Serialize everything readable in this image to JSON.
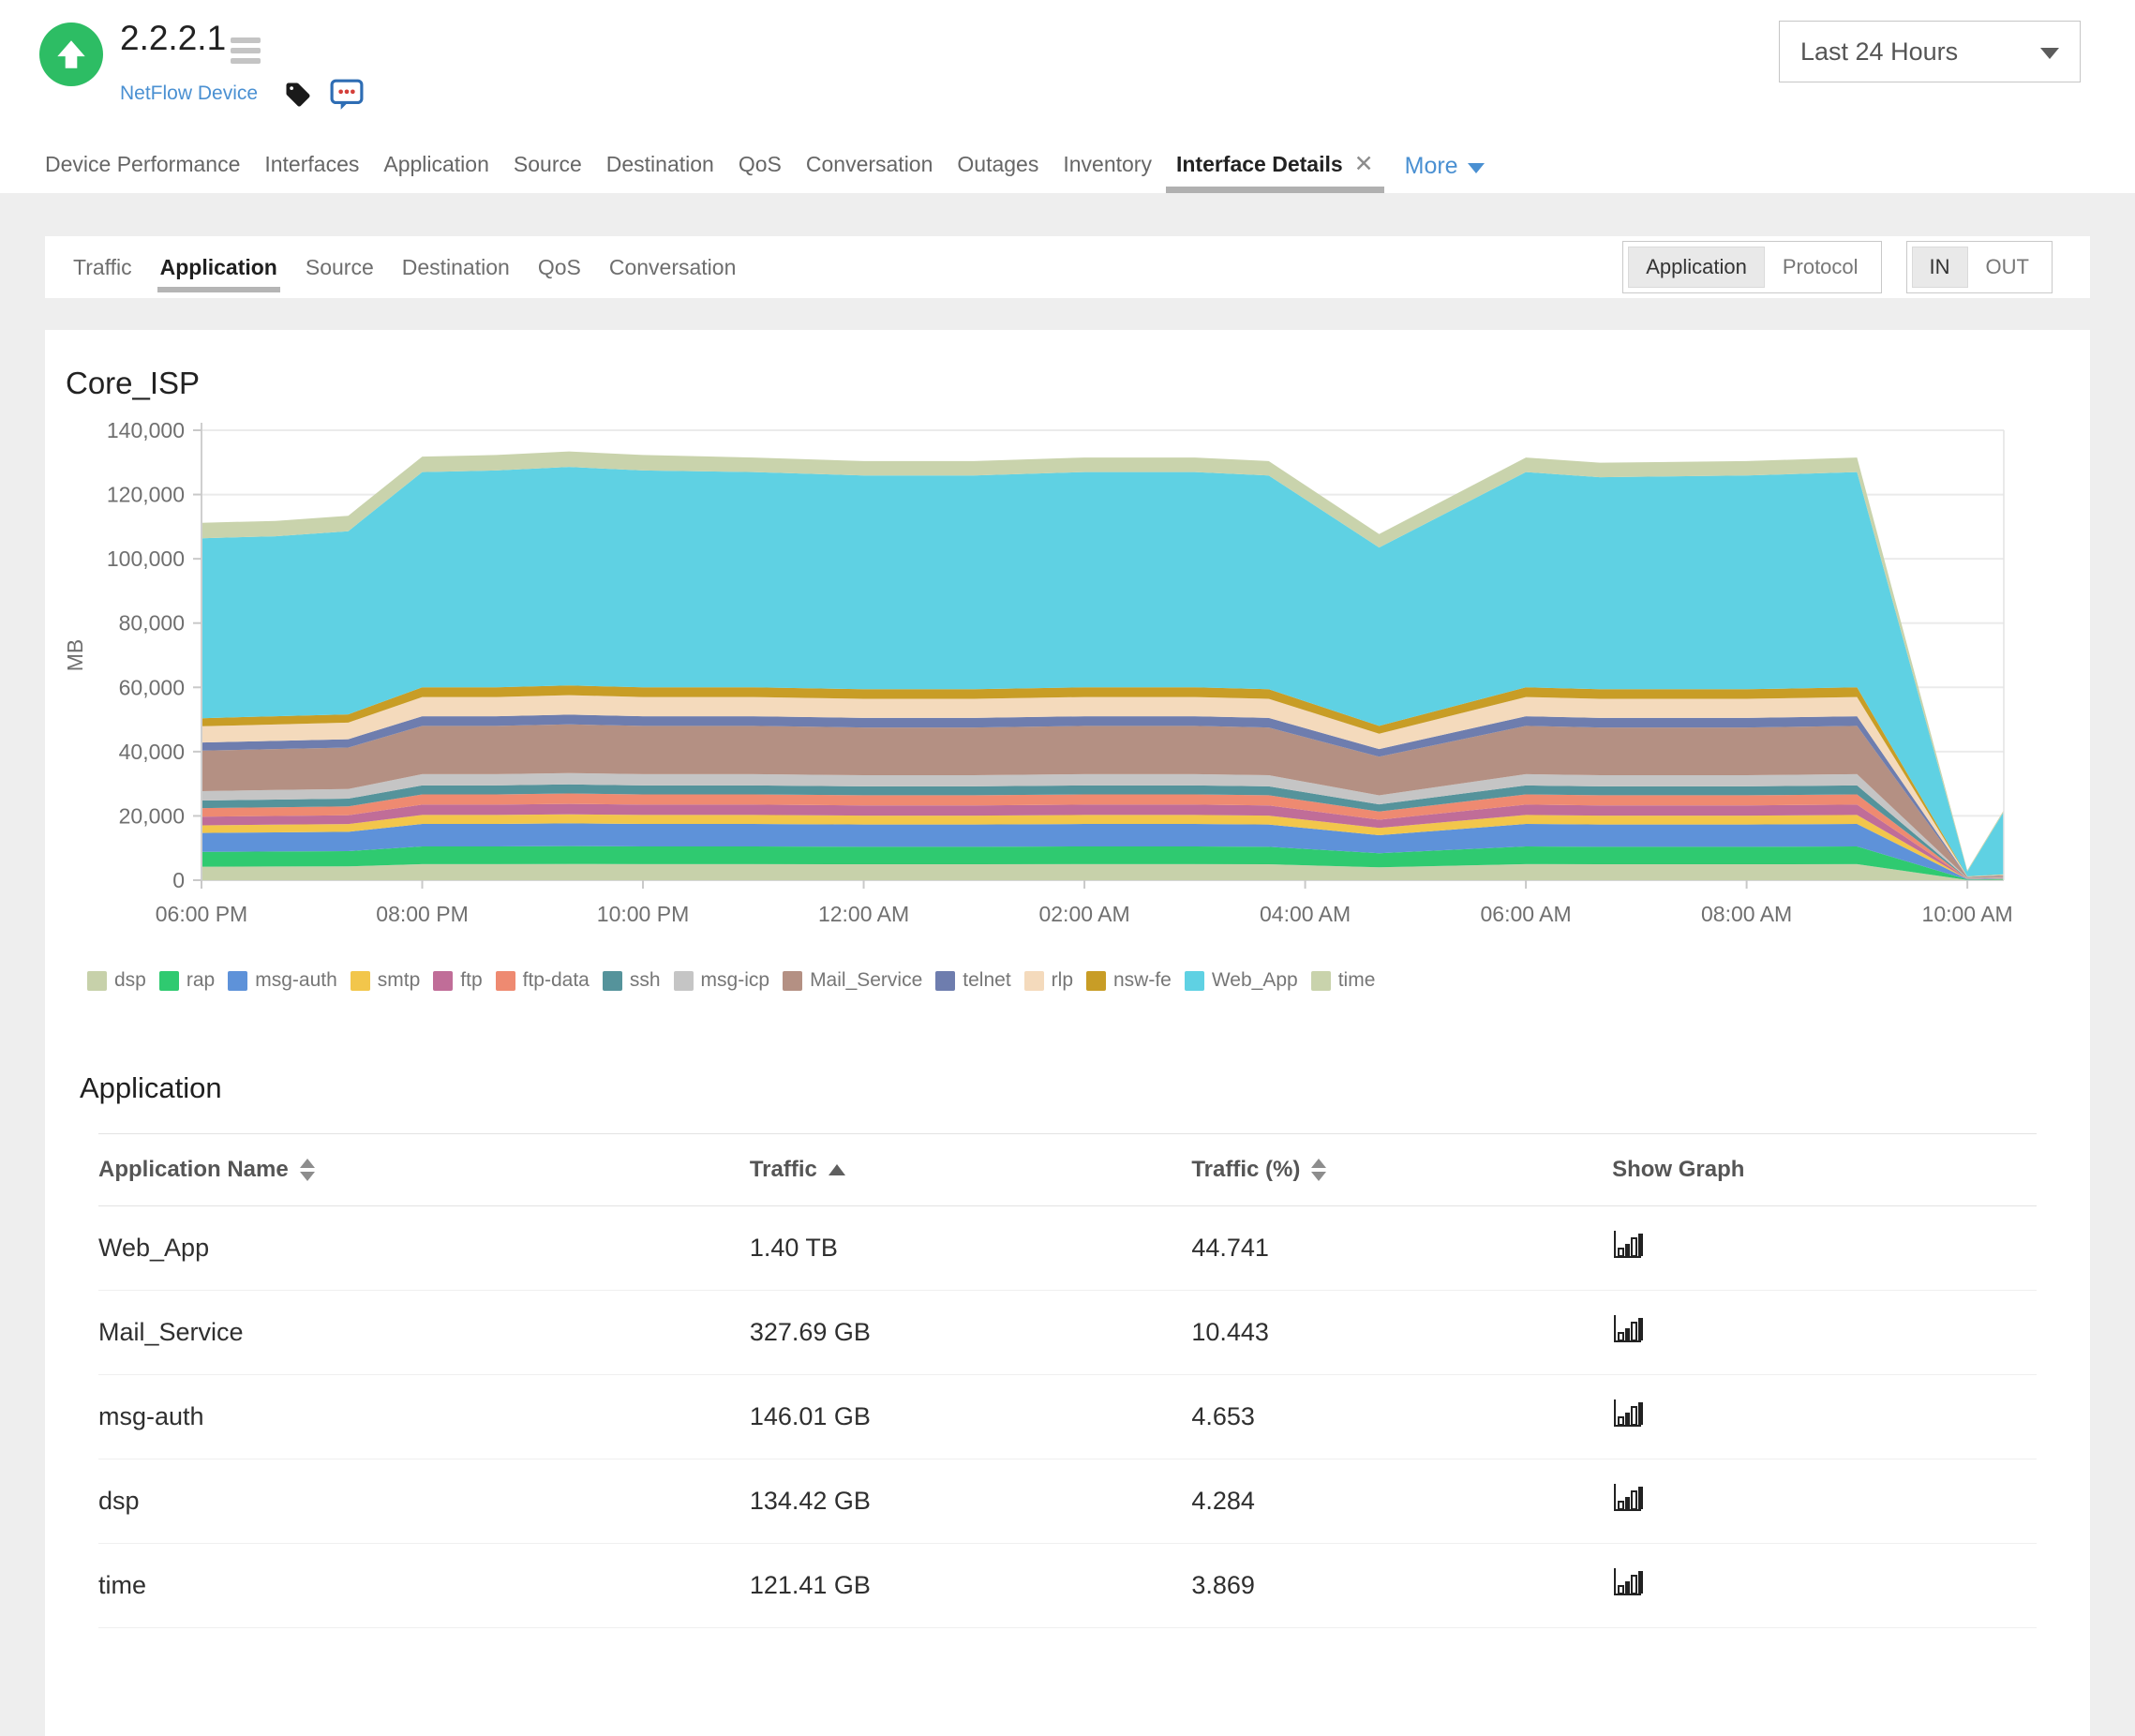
{
  "header": {
    "device_title": "2.2.2.1",
    "device_type": "NetFlow Device",
    "status": "up",
    "status_color": "#2dbd64",
    "time_range": "Last 24 Hours"
  },
  "nav": {
    "tabs": [
      "Device Performance",
      "Interfaces",
      "Application",
      "Source",
      "Destination",
      "QoS",
      "Conversation",
      "Outages",
      "Inventory"
    ],
    "active_tab": "Interface Details",
    "more_label": "More"
  },
  "subnav": {
    "tabs": [
      "Traffic",
      "Application",
      "Source",
      "Destination",
      "QoS",
      "Conversation"
    ],
    "active": "Application",
    "view_toggle": {
      "options": [
        "Application",
        "Protocol"
      ],
      "selected": "Application"
    },
    "direction_toggle": {
      "options": [
        "IN",
        "OUT"
      ],
      "selected": "IN"
    }
  },
  "chart": {
    "title": "Core_ISP",
    "ylabel": "MB"
  },
  "chart_data": {
    "type": "area",
    "stacked": true,
    "title": "Core_ISP",
    "ylabel": "MB",
    "ylim": [
      0,
      140000
    ],
    "yticks": [
      0,
      20000,
      40000,
      60000,
      80000,
      100000,
      120000,
      140000
    ],
    "grid": true,
    "legend_position": "bottom",
    "x_unit": "hours since 06:00 PM",
    "x_span": [
      0,
      16.33
    ],
    "x_hours": [
      0,
      0.67,
      1.33,
      2,
      2.67,
      3.33,
      4,
      5,
      6,
      7,
      8,
      9,
      9.67,
      10.67,
      12,
      12.67,
      14,
      15,
      16,
      16.33
    ],
    "xtick_hours": [
      0,
      2,
      4,
      6,
      8,
      10,
      12,
      14,
      16
    ],
    "xtick_labels": [
      "06:00 PM",
      "08:00 PM",
      "10:00 PM",
      "12:00 AM",
      "02:00 AM",
      "04:00 AM",
      "06:00 AM",
      "08:00 AM",
      "10:00 AM"
    ],
    "series": [
      {
        "name": "dsp",
        "color": "#c7d1aa",
        "values": [
          4200,
          4250,
          4300,
          5000,
          5000,
          5050,
          5000,
          5000,
          4950,
          4950,
          5000,
          5000,
          4950,
          4000,
          5000,
          4950,
          4950,
          5000,
          100,
          150
        ]
      },
      {
        "name": "rap",
        "color": "#2fca70",
        "values": [
          4620,
          4675,
          4730,
          5500,
          5500,
          5555,
          5500,
          5500,
          5445,
          5445,
          5500,
          5500,
          5445,
          4400,
          5500,
          5445,
          5445,
          5500,
          110,
          165
        ]
      },
      {
        "name": "msg-auth",
        "color": "#5e92d9",
        "values": [
          5880,
          5950,
          6020,
          7000,
          7000,
          7070,
          7000,
          7000,
          6930,
          6930,
          7000,
          7000,
          6930,
          5600,
          7000,
          6930,
          6930,
          7000,
          140,
          210
        ]
      },
      {
        "name": "smtp",
        "color": "#f2c64b",
        "values": [
          2352,
          2380,
          2408,
          2800,
          2800,
          2828,
          2800,
          2800,
          2772,
          2772,
          2800,
          2800,
          2772,
          2240,
          2800,
          2772,
          2772,
          2800,
          56,
          84
        ]
      },
      {
        "name": "ftp",
        "color": "#c06d98",
        "values": [
          2688,
          2720,
          2752,
          3200,
          3200,
          3232,
          3200,
          3200,
          3168,
          3168,
          3200,
          3200,
          3168,
          2560,
          3200,
          3168,
          3168,
          3200,
          64,
          96
        ]
      },
      {
        "name": "ftp-data",
        "color": "#ee8a71",
        "values": [
          2688,
          2720,
          2752,
          3200,
          3200,
          3232,
          3200,
          3200,
          3168,
          3168,
          3200,
          3200,
          3168,
          2560,
          3200,
          3168,
          3168,
          3200,
          64,
          96
        ]
      },
      {
        "name": "ssh",
        "color": "#55939b",
        "values": [
          2352,
          2380,
          2408,
          2800,
          2800,
          2828,
          2800,
          2800,
          2772,
          2772,
          2800,
          2800,
          2772,
          2240,
          2800,
          2772,
          2772,
          2800,
          56,
          84
        ]
      },
      {
        "name": "msg-icp",
        "color": "#c5c5c5",
        "values": [
          2940,
          2975,
          3010,
          3500,
          3500,
          3535,
          3500,
          3500,
          3465,
          3465,
          3500,
          3500,
          3465,
          2800,
          3500,
          3465,
          3465,
          3500,
          70,
          105
        ]
      },
      {
        "name": "Mail_Service",
        "color": "#b49083",
        "values": [
          12600,
          12750,
          12900,
          15000,
          15000,
          15150,
          15000,
          15000,
          14850,
          14850,
          15000,
          15000,
          14850,
          12000,
          15000,
          14850,
          14850,
          15000,
          300,
          450
        ]
      },
      {
        "name": "telnet",
        "color": "#6e7dae",
        "values": [
          2520,
          2550,
          2580,
          3000,
          3000,
          3030,
          3000,
          3000,
          2970,
          2970,
          3000,
          3000,
          2970,
          2400,
          3000,
          2970,
          2970,
          3000,
          60,
          90
        ]
      },
      {
        "name": "rlp",
        "color": "#f4dabc",
        "values": [
          5040,
          5100,
          5160,
          6000,
          6000,
          6060,
          6000,
          6000,
          5940,
          5940,
          6000,
          6000,
          5940,
          4800,
          6000,
          5940,
          5940,
          6000,
          120,
          180
        ]
      },
      {
        "name": "nsw-fe",
        "color": "#c89d26",
        "values": [
          2520,
          2550,
          2580,
          3000,
          3000,
          3030,
          3000,
          3000,
          2970,
          2970,
          3000,
          3000,
          2970,
          2400,
          3000,
          2970,
          2970,
          3000,
          60,
          90
        ]
      },
      {
        "name": "Web_App",
        "color": "#5fd1e3",
        "values": [
          56000,
          56000,
          57000,
          67000,
          67500,
          68000,
          67500,
          67000,
          66500,
          66500,
          67000,
          67000,
          66500,
          55500,
          67000,
          66000,
          66500,
          67000,
          1500,
          19500
        ]
      },
      {
        "name": "time",
        "color": "#c9d3ac",
        "values": [
          4800,
          4800,
          4800,
          4800,
          4800,
          4800,
          4800,
          4500,
          4500,
          4500,
          4500,
          4500,
          4500,
          4200,
          4500,
          4500,
          4500,
          4500,
          400,
          500
        ]
      }
    ]
  },
  "table": {
    "section_title": "Application",
    "columns": [
      "Application Name",
      "Traffic",
      "Traffic (%)",
      "Show Graph"
    ],
    "sort": {
      "column": "Traffic",
      "direction": "asc"
    },
    "rows": [
      {
        "name": "Web_App",
        "traffic": "1.40 TB",
        "traffic_pct": "44.741"
      },
      {
        "name": "Mail_Service",
        "traffic": "327.69 GB",
        "traffic_pct": "10.443"
      },
      {
        "name": "msg-auth",
        "traffic": "146.01 GB",
        "traffic_pct": "4.653"
      },
      {
        "name": "dsp",
        "traffic": "134.42 GB",
        "traffic_pct": "4.284"
      },
      {
        "name": "time",
        "traffic": "121.41 GB",
        "traffic_pct": "3.869"
      }
    ]
  }
}
